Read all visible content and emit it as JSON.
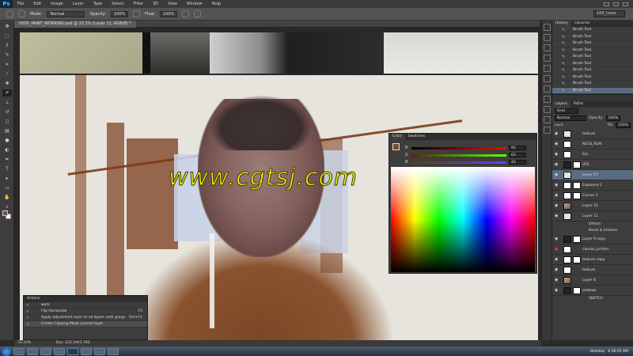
{
  "app": {
    "logo": "Ps",
    "menu": [
      "File",
      "Edit",
      "Image",
      "Layer",
      "Type",
      "Select",
      "Filter",
      "3D",
      "View",
      "Window",
      "Help"
    ]
  },
  "options": {
    "mode_label": "Mode:",
    "mode_value": "Normal",
    "opacity_label": "Opacity:",
    "opacity_value": "100%",
    "flow_label": "Flow:",
    "flow_value": "100%",
    "workspace": "100_lvsss"
  },
  "document": {
    "tab_title": "0500_PAINT_WORKING.psd @ 33.3% (Layer 11, RGB/8) *"
  },
  "watermark": "www.cgtsj.com",
  "color_panel": {
    "tabs": [
      "Color",
      "Swatches"
    ],
    "sliders": [
      {
        "channel": "R",
        "value": "95",
        "gradient": "linear-gradient(90deg,#000,#f00)"
      },
      {
        "channel": "G",
        "value": "63",
        "gradient": "linear-gradient(90deg,#602000,#60ff00)"
      },
      {
        "channel": "B",
        "value": "43",
        "gradient": "linear-gradient(90deg,#5f3f00,#5f3fff)"
      }
    ],
    "foreground_color": "#7a4a32"
  },
  "actions_panel": {
    "tab": "Actions",
    "rows": [
      {
        "label": "work",
        "shortcut": "",
        "checked": "✓",
        "highlight": false
      },
      {
        "label": "Flip Horizontal",
        "shortcut": "F3",
        "checked": "✓",
        "highlight": false
      },
      {
        "label": "Apply adjustment layer to all layers until group",
        "shortcut": "Ctrl+F2",
        "checked": "✓",
        "highlight": false
      },
      {
        "label": "Create Clipping Mask current layer",
        "shortcut": "",
        "checked": "✓",
        "highlight": true
      }
    ]
  },
  "status": {
    "zoom": "33.33%",
    "doc": "Doc: 222.1M/3.79G"
  },
  "history_panel": {
    "tabs": [
      "History",
      "Libraries"
    ],
    "items": [
      "Brush Tool",
      "Brush Tool",
      "Brush Tool",
      "Brush Tool",
      "Brush Tool",
      "Brush Tool",
      "Brush Tool",
      "Brush Tool",
      "Brush Tool",
      "Brush Tool"
    ]
  },
  "layers_panel": {
    "tabs": [
      "Layers",
      "Paths"
    ],
    "kind_label": "Kind",
    "blend_mode": "Normal",
    "opacity_label": "Opacity:",
    "opacity_value": "100%",
    "lock_label": "Lock:",
    "fill_label": "Fill:",
    "fill_value": "100%",
    "layers": [
      {
        "name": "texture",
        "thumb": "check",
        "mask": false,
        "selected": false,
        "sub": false
      },
      {
        "name": "NECK_RLM",
        "thumb": "white",
        "mask": false,
        "selected": false,
        "sub": false
      },
      {
        "name": "ELL",
        "thumb": "white",
        "mask": false,
        "selected": false,
        "sub": false
      },
      {
        "name": "VES",
        "thumb": "dark",
        "mask": true,
        "selected": false,
        "sub": false
      },
      {
        "name": "Layer 17",
        "thumb": "check",
        "mask": false,
        "selected": true,
        "sub": false
      },
      {
        "name": "Exposure 1",
        "thumb": "white",
        "mask": true,
        "selected": false,
        "sub": false
      },
      {
        "name": "Curves 1",
        "thumb": "white",
        "mask": true,
        "selected": false,
        "sub": false
      },
      {
        "name": "Layer 12",
        "thumb": "pic",
        "mask": false,
        "selected": false,
        "sub": false
      },
      {
        "name": "Layer 11",
        "thumb": "check",
        "mask": false,
        "selected": false,
        "sub": false
      },
      {
        "name": "Effects",
        "thumb": "",
        "mask": false,
        "selected": false,
        "sub": true
      },
      {
        "name": "Bevel & Emboss",
        "thumb": "",
        "mask": false,
        "selected": false,
        "sub": true
      },
      {
        "name": "Layer 9 copy",
        "thumb": "dark",
        "mask": true,
        "selected": false,
        "sub": false
      },
      {
        "name": "canvas_printer",
        "thumb": "white",
        "mask": false,
        "selected": false,
        "sub": false,
        "red": true
      },
      {
        "name": "texture copy",
        "thumb": "white",
        "mask": true,
        "selected": false,
        "sub": false
      },
      {
        "name": "texture",
        "thumb": "white",
        "mask": false,
        "selected": false,
        "sub": false
      },
      {
        "name": "Layer 8",
        "thumb": "pic",
        "mask": false,
        "selected": false,
        "sub": false
      },
      {
        "name": "andows",
        "thumb": "dark",
        "mask": true,
        "selected": false,
        "sub": false
      },
      {
        "name": "SKETCH",
        "thumb": "",
        "mask": false,
        "selected": false,
        "sub": true
      }
    ]
  },
  "taskbar": {
    "desktop_label": "Desktop",
    "clock": "6:36:55 AM"
  }
}
